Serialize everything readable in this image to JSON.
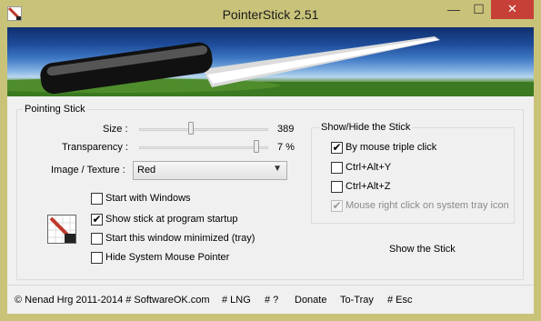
{
  "window": {
    "title": "PointerStick 2.51",
    "minimize_glyph": "—",
    "maximize_glyph": "☐",
    "close_glyph": "✕"
  },
  "pointing_stick": {
    "legend": "Pointing Stick",
    "size": {
      "label": "Size :",
      "value": "389",
      "level": 0.4
    },
    "transparency": {
      "label": "Transparency :",
      "value": "7 %",
      "level": 0.93
    },
    "texture": {
      "label": "Image / Texture :",
      "selected": "Red"
    },
    "options": [
      {
        "label": "Start with Windows",
        "checked": false
      },
      {
        "label": "Show stick at program startup",
        "checked": true
      },
      {
        "label": "Start this window minimized (tray)",
        "checked": false
      },
      {
        "label": "Hide System Mouse Pointer",
        "checked": false
      }
    ]
  },
  "show_hide": {
    "legend": "Show/Hide the Stick",
    "options": [
      {
        "label": "By mouse triple click",
        "checked": true,
        "disabled": false
      },
      {
        "label": "Ctrl+Alt+Y",
        "checked": false,
        "disabled": false
      },
      {
        "label": "Ctrl+Alt+Z",
        "checked": false,
        "disabled": false
      },
      {
        "label": "Mouse right click on system tray icon",
        "checked": true,
        "disabled": true
      }
    ],
    "show_button": "Show the Stick"
  },
  "footer": {
    "copyright": "© Nenad Hrg 2011-2014 # SoftwareOK.com",
    "lng": "# LNG",
    "help": "# ?",
    "donate": "Donate",
    "to_tray": "To-Tray",
    "esc": "# Esc"
  },
  "colors": {
    "frame": "#c9c37a",
    "close": "#c74038",
    "client": "#f0f0f0"
  },
  "icons": {
    "app": "pointerstick-app-icon",
    "large": "pointerstick-large-icon"
  }
}
